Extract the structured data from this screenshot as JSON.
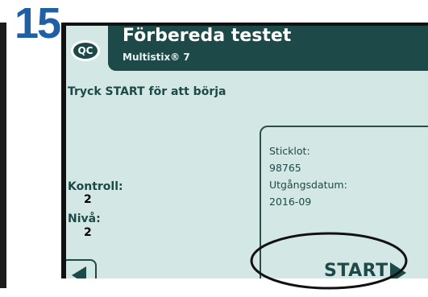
{
  "step": {
    "number": "15"
  },
  "header": {
    "badge": "QC",
    "title": "Förbereda testet",
    "subtitle": "Multistix® 7"
  },
  "prompt": "Tryck START för att börja",
  "kontroll": {
    "label": "Kontroll:",
    "value": "2"
  },
  "niva": {
    "label": "Nivå:",
    "value": "2"
  },
  "info": {
    "sticklot_label": "Sticklot:",
    "sticklot_value": "98765",
    "expiry_label": "Utgångsdatum:",
    "expiry_value": "2016-09"
  },
  "start_button": {
    "label": "START"
  },
  "icons": {
    "back": "arrow-left-icon",
    "start": "arrow-right-icon"
  },
  "colors": {
    "step_number": "#1f5fa6",
    "screen_bg": "#d3e8e4",
    "title_bar": "#1d4a49",
    "annotation": "#111111"
  }
}
